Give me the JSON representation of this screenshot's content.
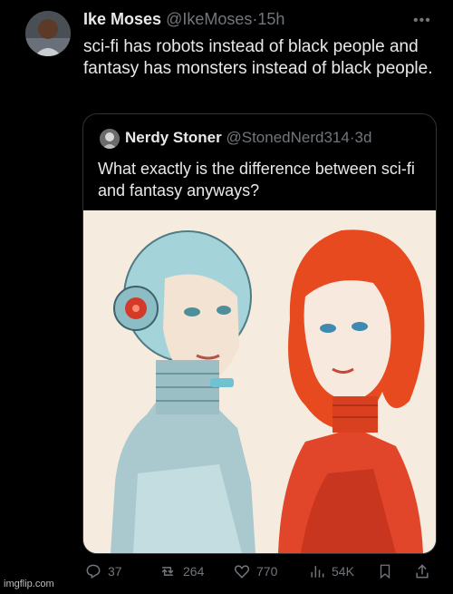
{
  "author": {
    "name": "Ike Moses",
    "handle": "@IkeMoses",
    "time": "15h",
    "text": "sci-fi has robots instead of black people and fantasy has monsters instead of black people."
  },
  "quoted": {
    "name": "Nerdy Stoner",
    "handle": "@StonedNerd314",
    "time": "3d",
    "text": "What exactly is the difference between sci-fi and fantasy anyways?"
  },
  "stats": {
    "replies": "37",
    "reposts": "264",
    "likes": "770",
    "views": "54K"
  },
  "icons": [
    "more-icon",
    "reply-icon",
    "repost-icon",
    "like-icon",
    "views-icon",
    "bookmark-icon",
    "share-icon"
  ],
  "watermark": "imgflip.com",
  "colors": {
    "background": "#000000",
    "text": "#e7e9ea",
    "muted": "#71767b",
    "border": "#2f3336"
  }
}
